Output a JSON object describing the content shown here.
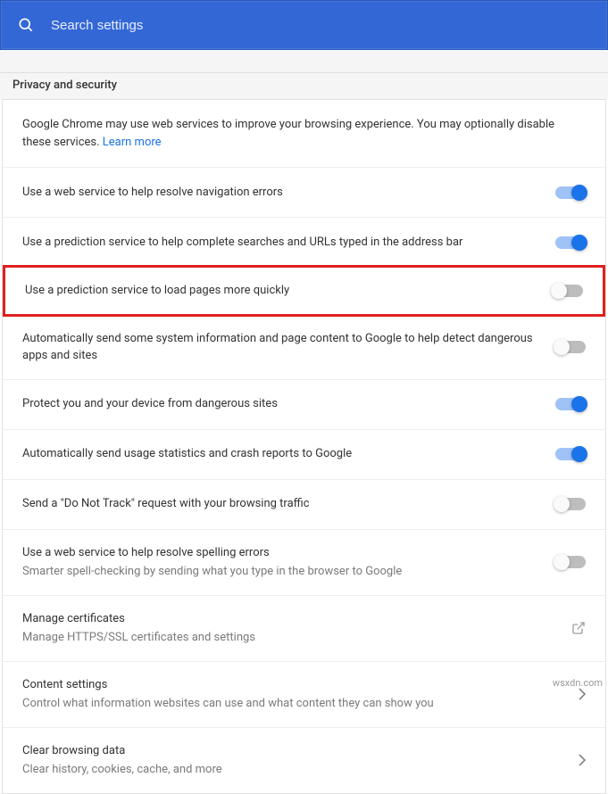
{
  "header": {
    "search_placeholder": "Search settings"
  },
  "section_title": "Privacy and security",
  "intro": {
    "text_before": "Google Chrome may use web services to improve your browsing experience. You may optionally disable these services. ",
    "link_text": "Learn more"
  },
  "rows": [
    {
      "label": "Use a web service to help resolve navigation errors",
      "sublabel": "",
      "control": "toggle",
      "on": true,
      "highlight": false
    },
    {
      "label": "Use a prediction service to help complete searches and URLs typed in the address bar",
      "sublabel": "",
      "control": "toggle",
      "on": true,
      "highlight": false
    },
    {
      "label": "Use a prediction service to load pages more quickly",
      "sublabel": "",
      "control": "toggle",
      "on": false,
      "highlight": true
    },
    {
      "label": "Automatically send some system information and page content to Google to help detect dangerous apps and sites",
      "sublabel": "",
      "control": "toggle",
      "on": false,
      "highlight": false
    },
    {
      "label": "Protect you and your device from dangerous sites",
      "sublabel": "",
      "control": "toggle",
      "on": true,
      "highlight": false
    },
    {
      "label": "Automatically send usage statistics and crash reports to Google",
      "sublabel": "",
      "control": "toggle",
      "on": true,
      "highlight": false
    },
    {
      "label": "Send a \"Do Not Track\" request with your browsing traffic",
      "sublabel": "",
      "control": "toggle",
      "on": false,
      "highlight": false
    },
    {
      "label": "Use a web service to help resolve spelling errors",
      "sublabel": "Smarter spell-checking by sending what you type in the browser to Google",
      "control": "toggle",
      "on": false,
      "highlight": false
    },
    {
      "label": "Manage certificates",
      "sublabel": "Manage HTTPS/SSL certificates and settings",
      "control": "external",
      "on": false,
      "highlight": false
    },
    {
      "label": "Content settings",
      "sublabel": "Control what information websites can use and what content they can show you",
      "control": "arrow",
      "on": false,
      "highlight": false
    },
    {
      "label": "Clear browsing data",
      "sublabel": "Clear history, cookies, cache, and more",
      "control": "arrow",
      "on": false,
      "highlight": false
    }
  ],
  "watermark": "wsxdn.com"
}
